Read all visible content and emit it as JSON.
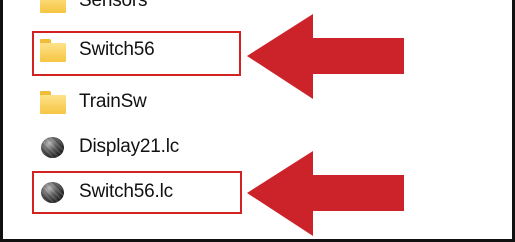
{
  "file_list": {
    "items": [
      {
        "label": "Sensors",
        "icon": "folder-icon"
      },
      {
        "label": "Switch56",
        "icon": "folder-icon",
        "highlighted": true
      },
      {
        "label": "TrainSw",
        "icon": "folder-icon"
      },
      {
        "label": "Display21.lc",
        "icon": "lc-file-icon"
      },
      {
        "label": "Switch56.lc",
        "icon": "lc-file-icon",
        "highlighted": true
      }
    ]
  },
  "annotations": {
    "highlight_color": "#d22222",
    "arrow_color": "#cc2229"
  }
}
